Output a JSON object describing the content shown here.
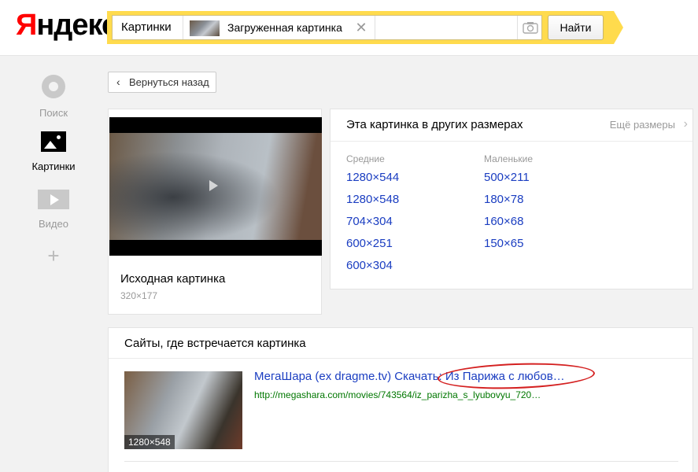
{
  "header": {
    "logo_first": "Я",
    "logo_rest": "ндекс",
    "service": "Картинки",
    "uploaded_label": "Загруженная картинка",
    "find_label": "Найти"
  },
  "nav": {
    "items": [
      {
        "label": "Поиск",
        "icon": "circle-icon",
        "active": false
      },
      {
        "label": "Картинки",
        "icon": "picture-icon",
        "active": true
      },
      {
        "label": "Видео",
        "icon": "video-icon",
        "active": false
      }
    ],
    "add_icon": "plus-icon"
  },
  "back": {
    "label": "Вернуться назад"
  },
  "original": {
    "title": "Исходная картинка",
    "size": "320×177"
  },
  "sizes": {
    "title": "Эта картинка в других размерах",
    "more": "Ещё размеры",
    "medium": {
      "header": "Средние",
      "items": [
        "1280×544",
        "1280×548",
        "704×304",
        "600×251",
        "600×304"
      ]
    },
    "small": {
      "header": "Маленькие",
      "items": [
        "500×211",
        "180×78",
        "160×68",
        "150×65"
      ]
    }
  },
  "sites": {
    "title": "Сайты, где встречается картинка",
    "results": [
      {
        "size_badge": "1280×548",
        "link": "МегаШара (ex dragme.tv) Скачать: Из Парижа с любов…",
        "url": "http://megashara.com/movies/743564/iz_parizha_s_lyubovyu_720…"
      }
    ]
  },
  "colors": {
    "accent_yellow": "#ffdb4d",
    "link_blue": "#1a3dc1",
    "url_green": "#007700",
    "highlight_red": "#d42020"
  }
}
